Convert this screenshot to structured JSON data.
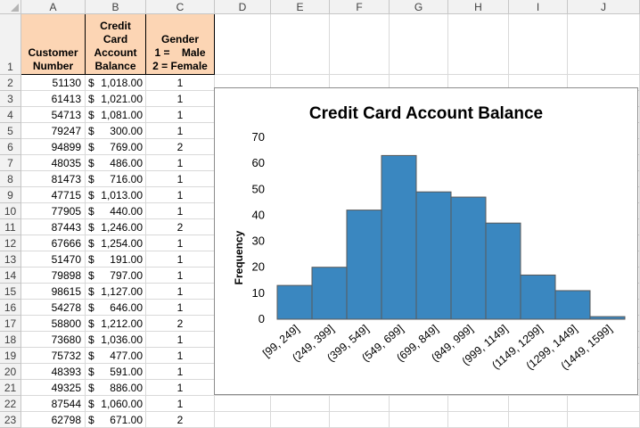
{
  "sheet": {
    "column_letters": [
      "A",
      "B",
      "C",
      "D",
      "E",
      "F",
      "G",
      "H",
      "I",
      "J"
    ],
    "header_row_number": "1",
    "headers": {
      "a": "Customer\nNumber",
      "b": "Credit\nCard\nAccount\nBalance",
      "c": "Gender\n1 =    Male\n2 = Female"
    },
    "rows": [
      {
        "n": "2",
        "customer": "51130",
        "dollar": "$",
        "amount": "1,018.00",
        "gender": "1"
      },
      {
        "n": "3",
        "customer": "61413",
        "dollar": "$",
        "amount": "1,021.00",
        "gender": "1"
      },
      {
        "n": "4",
        "customer": "54713",
        "dollar": "$",
        "amount": "1,081.00",
        "gender": "1"
      },
      {
        "n": "5",
        "customer": "79247",
        "dollar": "$",
        "amount": "300.00",
        "gender": "1"
      },
      {
        "n": "6",
        "customer": "94899",
        "dollar": "$",
        "amount": "769.00",
        "gender": "2"
      },
      {
        "n": "7",
        "customer": "48035",
        "dollar": "$",
        "amount": "486.00",
        "gender": "1"
      },
      {
        "n": "8",
        "customer": "81473",
        "dollar": "$",
        "amount": "716.00",
        "gender": "1"
      },
      {
        "n": "9",
        "customer": "47715",
        "dollar": "$",
        "amount": "1,013.00",
        "gender": "1"
      },
      {
        "n": "10",
        "customer": "77905",
        "dollar": "$",
        "amount": "440.00",
        "gender": "1"
      },
      {
        "n": "11",
        "customer": "87443",
        "dollar": "$",
        "amount": "1,246.00",
        "gender": "2"
      },
      {
        "n": "12",
        "customer": "67666",
        "dollar": "$",
        "amount": "1,254.00",
        "gender": "1"
      },
      {
        "n": "13",
        "customer": "51470",
        "dollar": "$",
        "amount": "191.00",
        "gender": "1"
      },
      {
        "n": "14",
        "customer": "79898",
        "dollar": "$",
        "amount": "797.00",
        "gender": "1"
      },
      {
        "n": "15",
        "customer": "98615",
        "dollar": "$",
        "amount": "1,127.00",
        "gender": "1"
      },
      {
        "n": "16",
        "customer": "54278",
        "dollar": "$",
        "amount": "646.00",
        "gender": "1"
      },
      {
        "n": "17",
        "customer": "58800",
        "dollar": "$",
        "amount": "1,212.00",
        "gender": "2"
      },
      {
        "n": "18",
        "customer": "73680",
        "dollar": "$",
        "amount": "1,036.00",
        "gender": "1"
      },
      {
        "n": "19",
        "customer": "75732",
        "dollar": "$",
        "amount": "477.00",
        "gender": "1"
      },
      {
        "n": "20",
        "customer": "48393",
        "dollar": "$",
        "amount": "591.00",
        "gender": "1"
      },
      {
        "n": "21",
        "customer": "49325",
        "dollar": "$",
        "amount": "886.00",
        "gender": "1"
      },
      {
        "n": "22",
        "customer": "87544",
        "dollar": "$",
        "amount": "1,060.00",
        "gender": "1"
      },
      {
        "n": "23",
        "customer": "62798",
        "dollar": "$",
        "amount": "671.00",
        "gender": "2"
      }
    ],
    "colors": {
      "header_fill": "#fcd5b4",
      "bar_fill": "#3a87c0",
      "bar_edge": "#595959"
    }
  },
  "chart_data": {
    "type": "bar",
    "title": "Credit Card Account Balance",
    "xlabel": "",
    "ylabel": "Frequency",
    "categories": [
      "[99, 249]",
      "(249, 399]",
      "(399, 549]",
      "(549, 699]",
      "(699, 849]",
      "(849, 999]",
      "(999, 1149]",
      "(1149, 1299]",
      "(1299, 1449]",
      "(1449, 1599]"
    ],
    "values": [
      13,
      20,
      42,
      63,
      49,
      47,
      37,
      17,
      11,
      1
    ],
    "ylim": [
      0,
      70
    ],
    "yticks": [
      "0",
      "10",
      "20",
      "30",
      "40",
      "50",
      "60",
      "70"
    ],
    "grid": false,
    "legend": "none"
  }
}
